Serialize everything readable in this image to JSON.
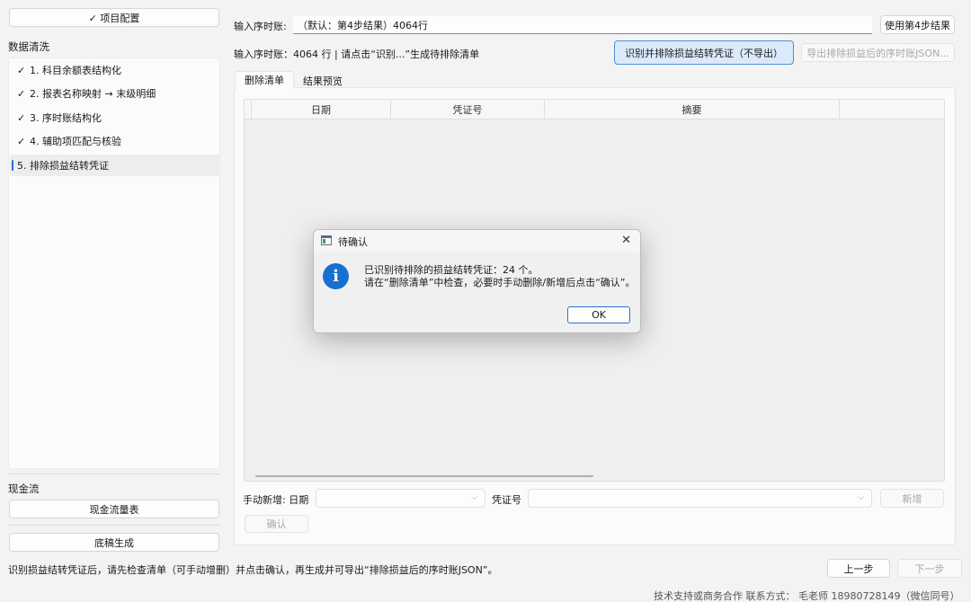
{
  "sidebar": {
    "project_config_label": "✓ 项目配置",
    "section_cleaning": "数据清洗",
    "items": [
      {
        "check": "✓",
        "label": "1. 科目余额表结构化"
      },
      {
        "check": "✓",
        "label": "2. 报表名称映射 → 末级明细"
      },
      {
        "check": "✓",
        "label": "3. 序时账结构化"
      },
      {
        "check": "✓",
        "label": "4. 辅助项匹配与核验"
      },
      {
        "check": "",
        "label": "5. 排除损益结转凭证"
      }
    ],
    "section_cashflow": "现金流",
    "cashflow_button": "现金流量表",
    "draft_button": "底稿生成"
  },
  "header": {
    "input_label": "输入序时账:",
    "input_value": "（默认：第4步结果）4064行",
    "use_step4_button": "使用第4步结果",
    "status_text": "输入序时账：4064 行 | 请点击“识别...”生成待排除清单",
    "identify_button": "识别并排除损益结转凭证（不导出）",
    "export_button": "导出排除损益后的序时账JSON..."
  },
  "tabs": [
    {
      "label": "删除清单",
      "active": true
    },
    {
      "label": "结果预览",
      "active": false
    }
  ],
  "table": {
    "columns": [
      "日期",
      "凭证号",
      "摘要"
    ]
  },
  "manual_add": {
    "label": "手动新增: 日期",
    "voucher_label": "凭证号",
    "add_button": "新增",
    "confirm_button": "确认"
  },
  "dialog": {
    "title": "待确认",
    "line1": "已识别待排除的损益结转凭证：24 个。",
    "line2": "请在“删除清单”中检查，必要时手动删除/新增后点击“确认”。",
    "ok_button": "OK",
    "close_glyph": "✕",
    "icon_glyph": "i"
  },
  "footer": {
    "hint": "识别损益结转凭证后，请先检查清单（可手动增删）并点击确认，再生成并可导出“排除损益后的序时账JSON”。",
    "prev_button": "上一步",
    "next_button": "下一步",
    "contact": "技术支持或商务合作 联系方式： 毛老师 18980728149（微信同号）"
  },
  "colors": {
    "accent": "#1670cf",
    "highlight_button_bg": "#dbeafb",
    "highlight_button_border": "#4a90d9"
  }
}
